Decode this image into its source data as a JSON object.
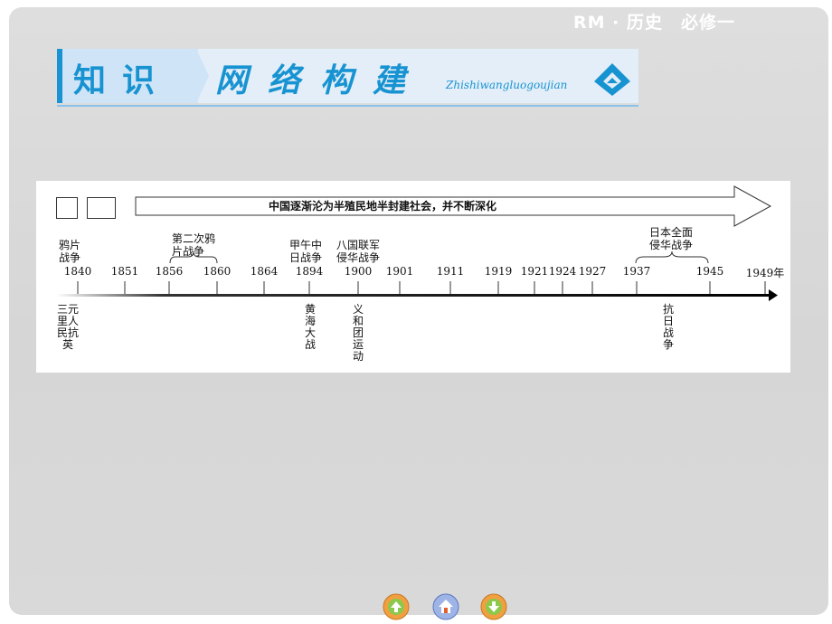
{
  "header": {
    "course": "RM · 历史　必修一"
  },
  "banner": {
    "title_a": "知识",
    "title_b": "网络构建",
    "pinyin": "Zhishiwangluogoujian"
  },
  "timeline": {
    "trend_text": "中国逐渐沦为半殖民地半封建社会，并不断深化",
    "years": [
      "1840",
      "1851",
      "1856",
      "1860",
      "1864",
      "1894",
      "1900",
      "1901",
      "1911",
      "1919",
      "1921",
      "1924",
      "1927",
      "1937",
      "1945",
      "1949年"
    ],
    "events_above": {
      "opium_war": "鸦片\n战争",
      "second_opium_war": "第二次鸦\n片战争",
      "sino_japanese_war": "甲午中\n日战争",
      "eight_nation": "八国联军\n侵华战争",
      "japan_invasion": "日本全面\n侵华战争"
    },
    "events_below": {
      "sanyuanli": "三元里人民抗英",
      "yellow_sea": "黄海大战",
      "boxer": "义和团运动",
      "anti_japan": "抗日战争"
    }
  },
  "nav": {
    "prev": "prev-icon",
    "home": "home-icon",
    "next": "next-icon"
  }
}
